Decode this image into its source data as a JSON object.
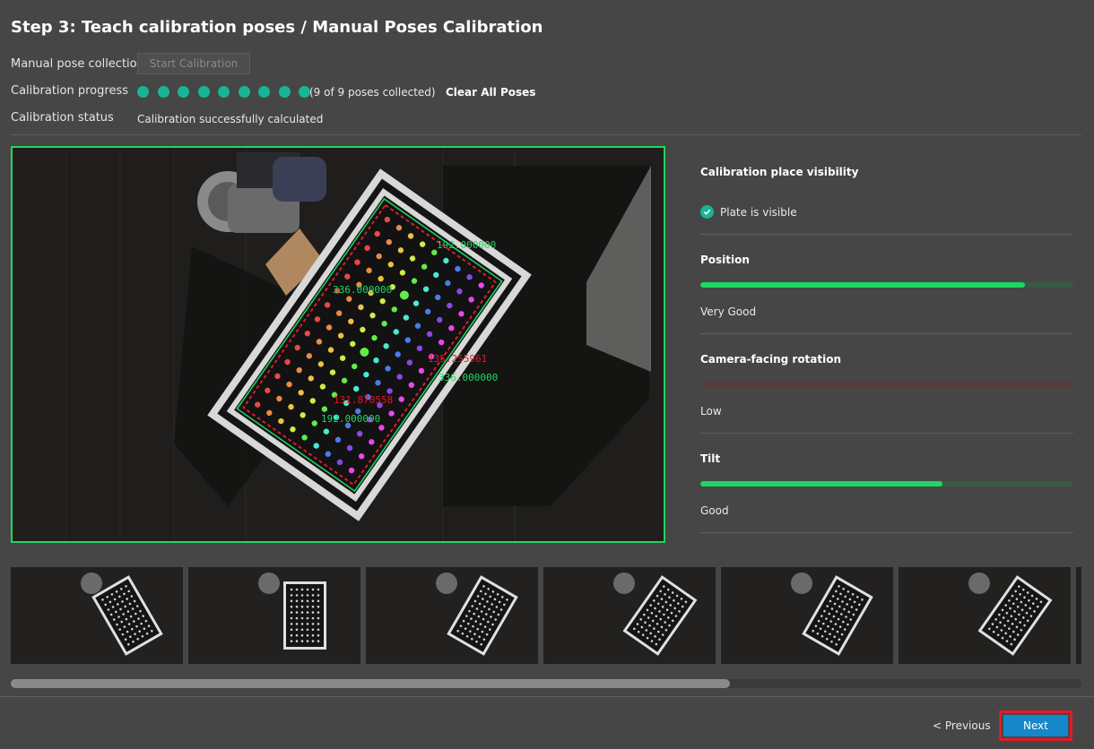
{
  "page": {
    "title": "Step 3: Teach calibration poses / Manual Poses Calibration"
  },
  "collection": {
    "label": "Manual pose collection",
    "start_button": "Start Calibration"
  },
  "progress": {
    "label": "Calibration progress",
    "collected": 9,
    "total": 9,
    "count_text": "(9 of 9 poses collected)",
    "clear_link": "Clear All Poses"
  },
  "status": {
    "label": "Calibration status",
    "value": "Calibration successfully calculated"
  },
  "camera": {
    "overlay_labels": [
      "192.000000",
      "336.000000",
      "336.000000",
      "135.255961",
      "131.870558",
      "192.000000"
    ],
    "border_color": "#1ed760"
  },
  "panel": {
    "visibility": {
      "heading": "Calibration place visibility",
      "value": "Plate is visible",
      "icon": "check-circle-icon"
    },
    "position": {
      "heading": "Position",
      "value": "Very Good",
      "level": 0.87
    },
    "rotation": {
      "heading": "Camera-facing rotation",
      "value": "Low",
      "level": 0.0
    },
    "tilt": {
      "heading": "Tilt",
      "value": "Good",
      "level": 0.65
    }
  },
  "thumbnails": {
    "count": 7
  },
  "footer": {
    "previous": "< Previous",
    "next": "Next"
  },
  "colors": {
    "accent_teal": "#19b495",
    "good_green": "#1ed760",
    "next_blue": "#1687c8",
    "highlight_red": "#e01a2a"
  }
}
